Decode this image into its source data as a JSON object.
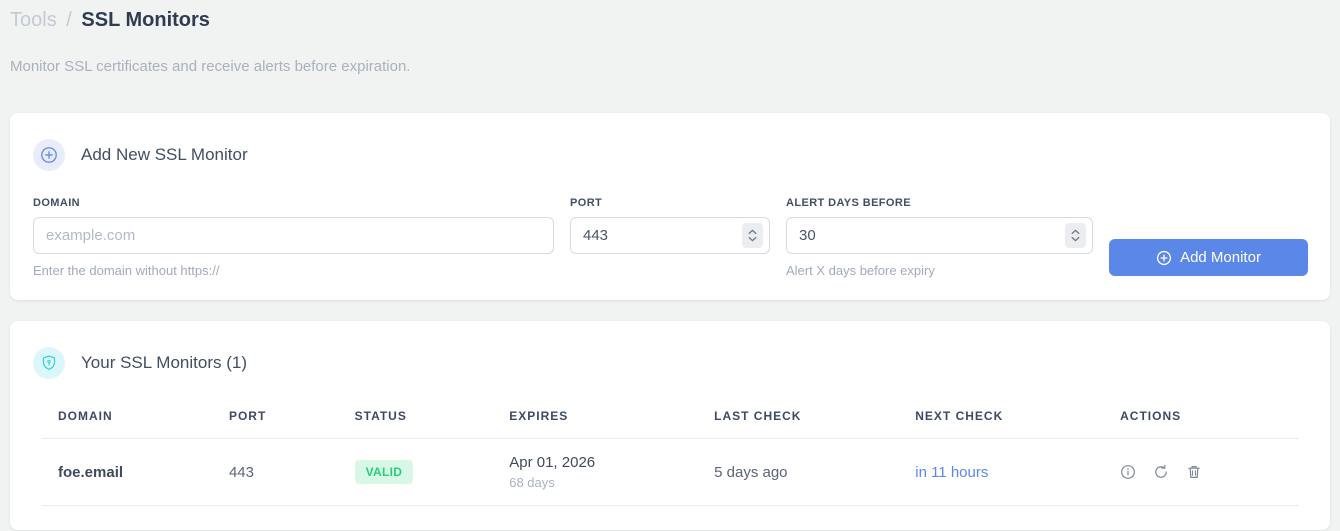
{
  "page": {
    "breadcrumb": {
      "parent": "Tools",
      "separator": "/",
      "current": "SSL Monitors"
    },
    "subtitle": "Monitor SSL certificates and receive alerts before expiration."
  },
  "add_monitor": {
    "title": "Add New SSL Monitor",
    "title_icon": "plus-circle-icon",
    "fields": {
      "domain": {
        "label": "DOMAIN",
        "placeholder": "example.com",
        "value": "",
        "helper": "Enter the domain without https://"
      },
      "port": {
        "label": "PORT",
        "value": "443"
      },
      "alert_days": {
        "label": "ALERT DAYS BEFORE",
        "value": "30",
        "helper": "Alert X days before expiry"
      }
    },
    "submit_label": "Add Monitor",
    "submit_icon": "plus-circle-icon"
  },
  "monitors": {
    "title": "Your SSL Monitors (1)",
    "title_icon": "shield-icon",
    "count": 1,
    "table": {
      "headers": [
        "DOMAIN",
        "PORT",
        "STATUS",
        "EXPIRES",
        "LAST CHECK",
        "NEXT CHECK",
        "ACTIONS"
      ],
      "rows": [
        {
          "domain": "foe.email",
          "port": "443",
          "status": "VALID",
          "expires_date": "Apr 01, 2026",
          "expires_days": "68 days",
          "last_check": "5 days ago",
          "next_check": "in 11 hours",
          "actions": [
            "info-icon",
            "refresh-icon",
            "trash-icon"
          ]
        }
      ]
    }
  },
  "colors": {
    "page_background": "#f1f3f2",
    "card_background": "#ffffff",
    "accent_blue": "#5b87e8",
    "valid_text": "#27cf7d",
    "valid_background": "#d9f7e6",
    "shield_teal": "#35d3dd",
    "heading_dark": "#2f3b50",
    "muted_gray": "#a9b1bf",
    "icon_gray": "#7d8799"
  }
}
